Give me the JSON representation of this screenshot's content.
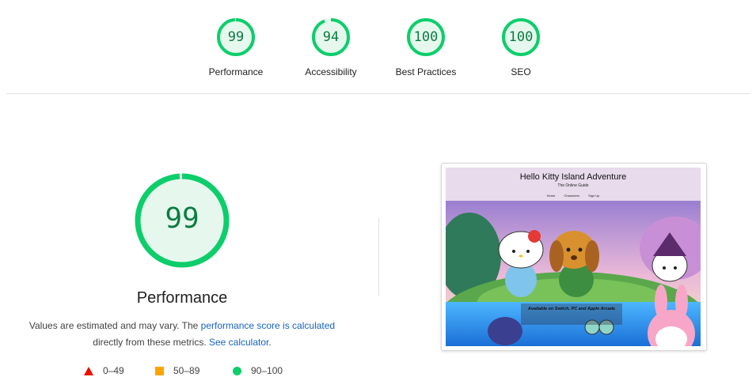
{
  "categories": [
    {
      "label": "Performance",
      "score": "99",
      "value": 0.99
    },
    {
      "label": "Accessibility",
      "score": "94",
      "value": 0.94
    },
    {
      "label": "Best Practices",
      "score": "100",
      "value": 1.0
    },
    {
      "label": "SEO",
      "score": "100",
      "value": 1.0
    }
  ],
  "main": {
    "score": "99",
    "value": 0.99,
    "title": "Performance",
    "desc_prefix": "Values are estimated and may vary. The ",
    "desc_link1": "performance score is calculated",
    "desc_line2_prefix": "directly from these metrics. ",
    "desc_link2": "See calculator",
    "desc_suffix": "."
  },
  "legend": [
    {
      "label": "0–49",
      "shape": "triangle",
      "color": "#eb0f00"
    },
    {
      "label": "50–89",
      "shape": "square",
      "color": "#ffa400"
    },
    {
      "label": "90–100",
      "shape": "circle",
      "color": "#0cce6b"
    }
  ],
  "screenshot": {
    "site_title": "Hello Kitty Island Adventure",
    "site_subtitle": "The Online Guide",
    "nav": [
      "Home",
      "Characters",
      "Sign Up"
    ],
    "banner": "Available on Switch, PC and Apple Arcade"
  },
  "colors": {
    "pass_ring": "#0cce6b",
    "pass_fill": "#e6f8ed",
    "pass_text": "#0a7c42",
    "link": "#1565c0"
  }
}
